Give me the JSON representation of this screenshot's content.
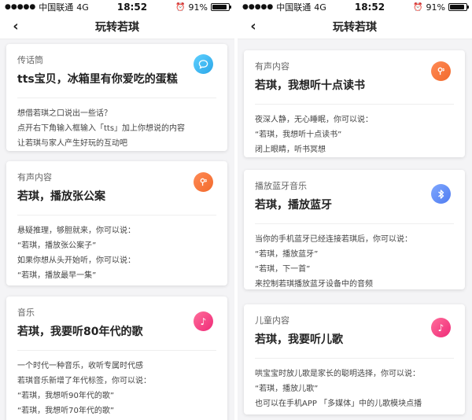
{
  "colors": {
    "page_bg": "#f4f4f6",
    "blue_icon": "#35b5f2",
    "orange_icon": "#f5773a",
    "pink_icon": "#f23f82",
    "bluetooth_icon": "#6590f7"
  },
  "left_screen": {
    "status": {
      "carrier": "中国联通",
      "network": "4G",
      "time": "18:52",
      "battery": "91%",
      "battery_level": 0.91
    },
    "nav": {
      "title": "玩转若琪",
      "back_icon": "chevron-left"
    },
    "cards": [
      {
        "category": "传话筒",
        "headline": "tts宝贝，冰箱里有你爱吃的蛋糕",
        "icon": "chat-bubble",
        "lines": [
          "想借若琪之口说出一些话？",
          "点开右下角输入框输入「tts」加上你想说的内容",
          "让若琪与家人产生好玩的互动吧"
        ]
      },
      {
        "category": "有声内容",
        "headline": "若琪，播放张公案",
        "icon": "audio-content",
        "lines": [
          "悬疑推理，够胆就来，你可以说：",
          "“若琪，播放张公案子”",
          "如果你想从头开始听，你可以说：",
          "“若琪，播放最早一集”"
        ]
      },
      {
        "category": "音乐",
        "headline": "若琪，我要听80年代的歌",
        "icon": "music-note",
        "lines": [
          "一个时代一种音乐，收听专属时代感",
          "若琪音乐新增了年代标签，你可以说：",
          "“若琪，我想听90年代的歌”",
          "“若琪，我想听70年代的歌”"
        ]
      }
    ]
  },
  "right_screen": {
    "status": {
      "carrier": "中国联通",
      "network": "4G",
      "time": "18:52",
      "battery": "91%",
      "battery_level": 0.91
    },
    "nav": {
      "title": "玩转若琪",
      "back_icon": "chevron-left"
    },
    "cards": [
      {
        "category": "有声内容",
        "headline": "若琪，我想听十点读书",
        "icon": "audio-content",
        "lines": [
          "夜深人静，无心睡眠，你可以说：",
          "“若琪，我想听十点读书”",
          "闭上眼睛，听书冥想"
        ]
      },
      {
        "category": "播放蓝牙音乐",
        "headline": "若琪，播放蓝牙",
        "icon": "bluetooth",
        "lines": [
          "当你的手机蓝牙已经连接若琪后，你可以说：",
          "“若琪，播放蓝牙”",
          "“若琪，下一首”",
          "来控制若琪播放蓝牙设备中的音频"
        ]
      },
      {
        "category": "儿童内容",
        "headline": "若琪，我要听儿歌",
        "icon": "music-note",
        "lines": [
          "哄宝宝时放儿歌是家长的聪明选择，你可以说：",
          "“若琪，播放儿歌”",
          "也可以在手机APP 「多媒体」中的儿歌模块点播"
        ]
      }
    ]
  }
}
